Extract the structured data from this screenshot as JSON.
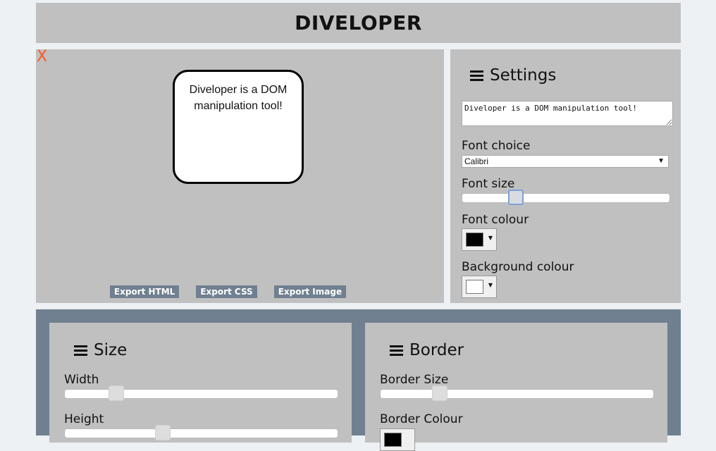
{
  "header": {
    "title": "DIVELOPER"
  },
  "canvas": {
    "close_label": "X",
    "div_text": "Diveloper is a DOM manipulation tool!",
    "exports": [
      "Export HTML",
      "Export CSS",
      "Export Image"
    ]
  },
  "settings": {
    "title": "Settings",
    "text_value": "Diveloper is a DOM manipulation tool!",
    "font_choice_label": "Font choice",
    "font_choice_value": "Calibri",
    "font_size_label": "Font size",
    "font_size_value": 0.24,
    "font_colour_label": "Font colour",
    "font_colour": "#000000",
    "background_colour_label": "Background colour",
    "background_colour": "#ffffff"
  },
  "size": {
    "title": "Size",
    "width_label": "Width",
    "width_value": 0.17,
    "height_label": "Height",
    "height_value": 0.35
  },
  "border": {
    "title": "Border",
    "border_size_label": "Border Size",
    "border_size_value": 0.2,
    "border_colour_label": "Border Colour",
    "border_colour": "#000000"
  },
  "colors": {
    "panel": "#c0c0c0",
    "accent": "#708090",
    "close": "#ff5722"
  }
}
